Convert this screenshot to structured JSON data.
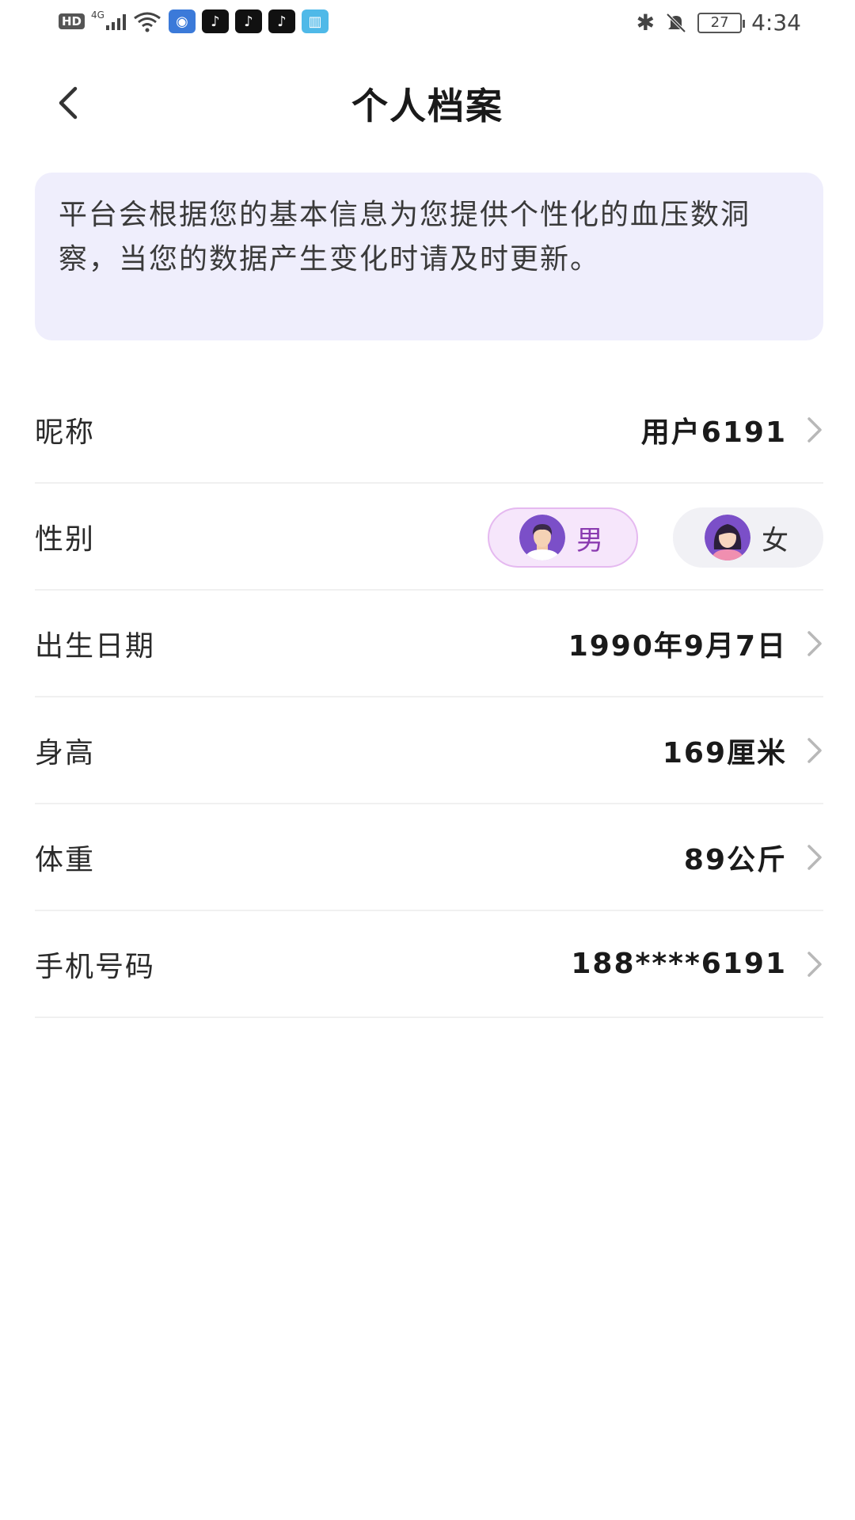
{
  "status_bar": {
    "hd": "HD",
    "network": "4G",
    "time": "4:34",
    "battery": "27",
    "icons": [
      "signal-icon",
      "wifi-icon",
      "app-icon",
      "tiktok-icon",
      "tiktok-icon",
      "tiktok-icon",
      "book-icon",
      "bluetooth-icon",
      "bell-muted-icon",
      "battery-icon"
    ]
  },
  "header": {
    "title": "个人档案",
    "back_icon": "chevron-left-icon"
  },
  "notice": {
    "text": "平台会根据您的基本信息为您提供个性化的血压数洞察，当您的数据产生变化时请及时更新。"
  },
  "profile": {
    "rows": [
      {
        "label": "昵称",
        "value": "用户6191"
      },
      {
        "label": "性别",
        "value": ""
      },
      {
        "label": "出生日期",
        "value": "1990年9月7日"
      },
      {
        "label": "身高",
        "value": "169厘米"
      },
      {
        "label": "体重",
        "value": "89公斤"
      },
      {
        "label": "手机号码",
        "value": "188****6191"
      }
    ],
    "gender": {
      "male_label": "男",
      "female_label": "女",
      "selected": "男"
    }
  },
  "colors": {
    "accent_purple": "#8a3bb0",
    "notice_bg": "#efeefc",
    "male_bg": "#f6e6fb",
    "female_bg": "#f1f1f5"
  }
}
